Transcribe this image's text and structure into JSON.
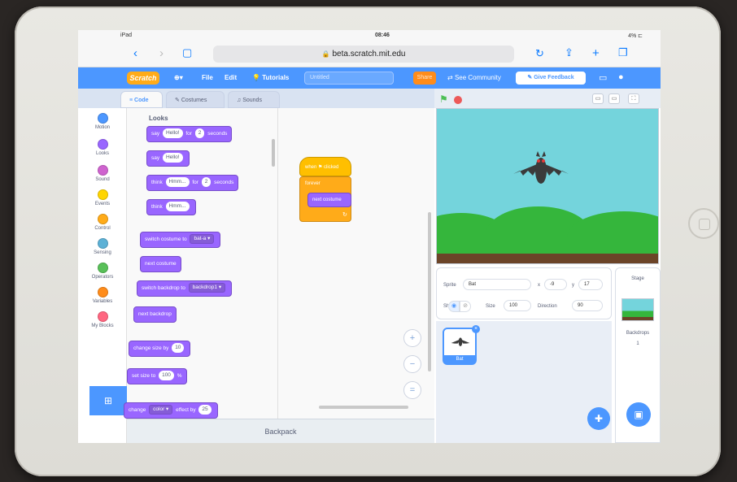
{
  "status_bar": {
    "carrier": "iPad",
    "time": "08:46",
    "battery": "4% ⊏"
  },
  "browser": {
    "url": "beta.scratch.mit.edu",
    "back_icon": "chevron-left-icon",
    "forward_icon": "chevron-right-icon",
    "bookmarks_icon": "book-icon",
    "reload_icon": "reload-icon",
    "share_icon": "share-icon",
    "new_tab_icon": "plus-icon",
    "tabs_icon": "tabs-icon"
  },
  "menu": {
    "logo": "Scratch",
    "language": "⊕▾",
    "file": "File",
    "edit": "Edit",
    "tutorials": "Tutorials",
    "project_title": "Untitled",
    "share": "Share",
    "see_community": "See Community",
    "give_feedback": "Give Feedback"
  },
  "tabs": [
    {
      "label": "Code",
      "active": true
    },
    {
      "label": "Costumes",
      "active": false
    },
    {
      "label": "Sounds",
      "active": false
    }
  ],
  "categories": [
    {
      "label": "Motion",
      "color": "#4c97ff"
    },
    {
      "label": "Looks",
      "color": "#9966ff"
    },
    {
      "label": "Sound",
      "color": "#cf63cf"
    },
    {
      "label": "Events",
      "color": "#ffd500"
    },
    {
      "label": "Control",
      "color": "#ffab19"
    },
    {
      "label": "Sensing",
      "color": "#5cb1d6"
    },
    {
      "label": "Operators",
      "color": "#59c059"
    },
    {
      "label": "Variables",
      "color": "#ff8c1a"
    },
    {
      "label": "My Blocks",
      "color": "#ff6680"
    }
  ],
  "palette": {
    "heading": "Looks",
    "blocks": {
      "say_for": {
        "a": "say",
        "b": "Hello!",
        "c": "for",
        "d": "2",
        "e": "seconds"
      },
      "say": {
        "a": "say",
        "b": "Hello!"
      },
      "think_for": {
        "a": "think",
        "b": "Hmm...",
        "c": "for",
        "d": "2",
        "e": "seconds"
      },
      "think": {
        "a": "think",
        "b": "Hmm..."
      },
      "switch_costume": {
        "a": "switch costume to",
        "b": "bat-a ▾"
      },
      "next_costume": "next costume",
      "switch_backdrop": {
        "a": "switch backdrop to",
        "b": "backdrop1 ▾"
      },
      "next_backdrop": "next backdrop",
      "change_size": {
        "a": "change size by",
        "b": "10"
      },
      "set_size": {
        "a": "set size to",
        "b": "100",
        "c": "%"
      },
      "change_effect": {
        "a": "change",
        "b": "color ▾",
        "c": "effect by",
        "d": "25"
      }
    }
  },
  "script": {
    "hat": "when ⚑ clicked",
    "forever": "forever",
    "inner": "next costume",
    "loop_arrow": "↻"
  },
  "zoom": {
    "in": "+",
    "out": "−",
    "reset": "="
  },
  "backpack": "Backpack",
  "stage_controls": {
    "small": "▭",
    "large": "▭",
    "fullscreen": "⛶"
  },
  "sprite_info": {
    "sprite_label": "Sprite",
    "sprite_name": "Bat",
    "x_label": "x",
    "x_value": "-9",
    "y_label": "y",
    "y_value": "17",
    "show_label": "Show",
    "size_label": "Size",
    "size_value": "100",
    "direction_label": "Direction",
    "direction_value": "90"
  },
  "sprites": [
    {
      "name": "Bat",
      "selected": true
    }
  ],
  "stage_panel": {
    "title": "Stage",
    "backdrops_label": "Backdrops",
    "backdrops_count": "1"
  }
}
